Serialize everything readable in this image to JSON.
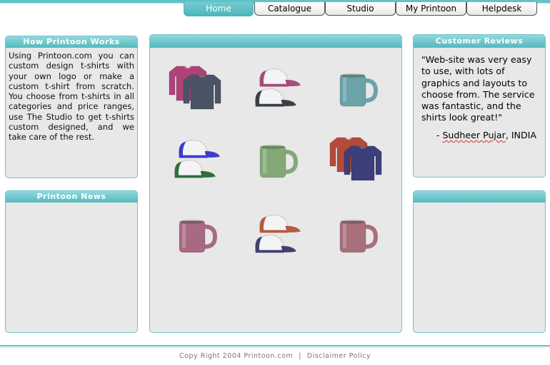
{
  "nav": {
    "tabs": [
      {
        "label": "Home",
        "active": true
      },
      {
        "label": "Catalogue",
        "active": false
      },
      {
        "label": "Studio",
        "active": false
      },
      {
        "label": "My Printoon",
        "active": false
      },
      {
        "label": "Helpdesk",
        "active": false
      }
    ]
  },
  "left": {
    "how_works": {
      "title": "How Printoon Works",
      "body": "Using Printoon.com you can custom design t-shirts with your own logo or make a custom t-shirt from scratch. You choose from t-shirts in all categories and price ranges, use The Studio to get t-shirts custom designed, and we take care of the rest."
    },
    "news": {
      "title": "Printoon News"
    }
  },
  "center": {
    "products": [
      {
        "type": "tshirt",
        "colors": [
          "#b0427a",
          "#4a5466"
        ]
      },
      {
        "type": "cap",
        "colors": [
          "#a64a7a",
          "#3a4048"
        ]
      },
      {
        "type": "mug",
        "colors": [
          "#6aa3a8"
        ]
      },
      {
        "type": "cap",
        "colors": [
          "#3b3ec9",
          "#2f6f3a"
        ]
      },
      {
        "type": "mug",
        "colors": [
          "#85a877"
        ]
      },
      {
        "type": "tshirt",
        "colors": [
          "#b5493a",
          "#3d3f7a"
        ]
      },
      {
        "type": "mug",
        "colors": [
          "#a86a82"
        ]
      },
      {
        "type": "cap",
        "colors": [
          "#b85a3e",
          "#40406e"
        ]
      },
      {
        "type": "mug",
        "colors": [
          "#a8707a"
        ]
      }
    ]
  },
  "right": {
    "reviews": {
      "title": "Customer Reviews",
      "quote": "\"Web-site was very easy to use, with lots of graphics and layouts to choose from. The service was fantastic, and the shirts look great!\"",
      "dash": "- ",
      "author_name": "Sudheer Pujar",
      "author_rest": ", INDIA"
    }
  },
  "footer": {
    "copyright": "Copy Right 2004 Printoon.com",
    "separator": "|",
    "disclaimer": "Disclaimer Policy"
  },
  "colors": {
    "accent": "#5fc3c8",
    "panel_bg": "#e8e8e8"
  }
}
